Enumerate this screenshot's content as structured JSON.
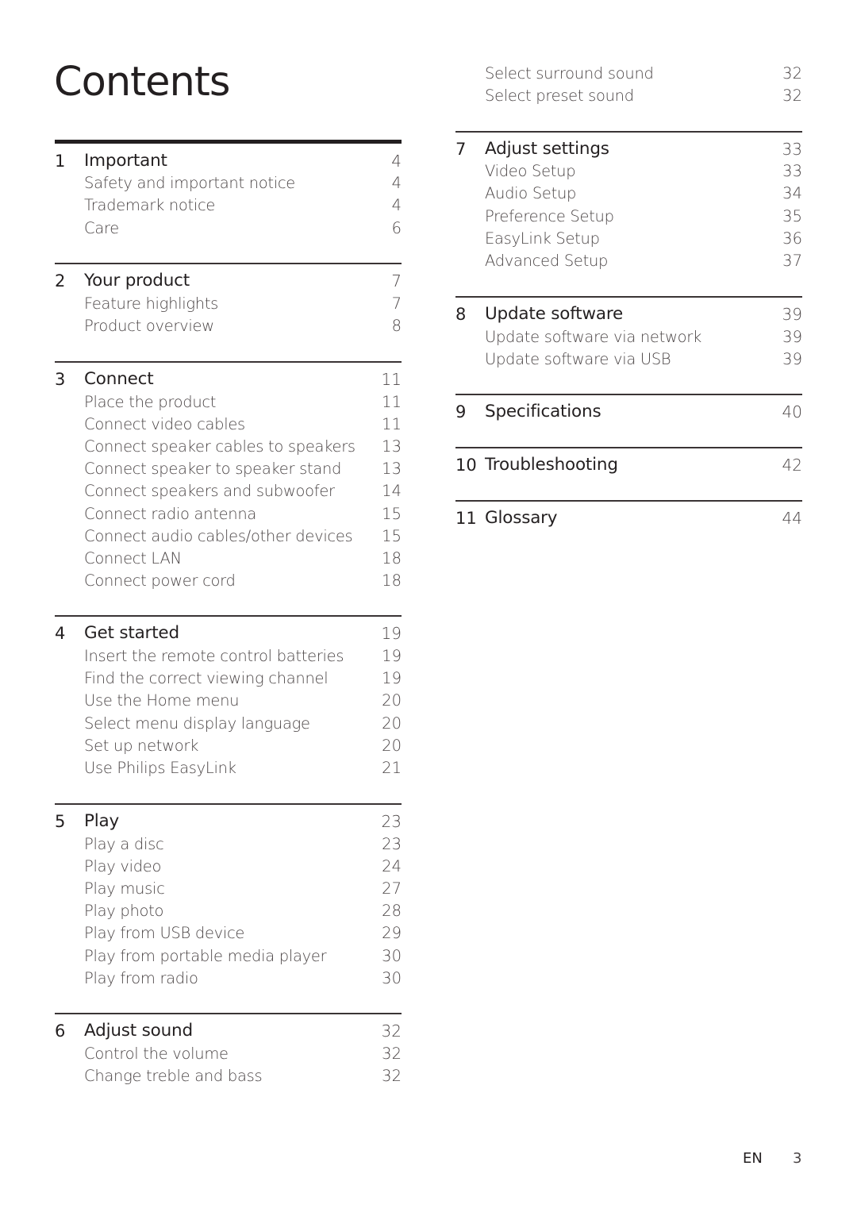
{
  "title": "Contents",
  "footer": {
    "language": "EN",
    "page_number": "3"
  },
  "sections": [
    {
      "number": "1",
      "title": "Important",
      "page": "4",
      "items": [
        {
          "label": "Safety and important notice",
          "page": "4"
        },
        {
          "label": "Trademark notice",
          "page": "4"
        },
        {
          "label": "Care",
          "page": "6"
        }
      ]
    },
    {
      "number": "2",
      "title": "Your product",
      "page": "7",
      "items": [
        {
          "label": "Feature highlights",
          "page": "7"
        },
        {
          "label": "Product overview",
          "page": "8"
        }
      ]
    },
    {
      "number": "3",
      "title": "Connect",
      "page": "11",
      "items": [
        {
          "label": "Place the product",
          "page": "11"
        },
        {
          "label": "Connect video cables",
          "page": "11"
        },
        {
          "label": "Connect speaker cables to speakers",
          "page": "13"
        },
        {
          "label": "Connect speaker to speaker stand",
          "page": "13"
        },
        {
          "label": "Connect speakers and subwoofer",
          "page": "14"
        },
        {
          "label": "Connect radio antenna",
          "page": "15"
        },
        {
          "label": "Connect audio cables/other devices",
          "page": "15"
        },
        {
          "label": "Connect LAN",
          "page": "18"
        },
        {
          "label": "Connect power cord",
          "page": "18"
        }
      ]
    },
    {
      "number": "4",
      "title": "Get started",
      "page": "19",
      "items": [
        {
          "label": "Insert the remote control batteries",
          "page": "19"
        },
        {
          "label": "Find the correct viewing channel",
          "page": "19"
        },
        {
          "label": "Use the Home menu",
          "page": "20"
        },
        {
          "label": "Select menu display language",
          "page": "20"
        },
        {
          "label": "Set up network",
          "page": "20"
        },
        {
          "label": "Use Philips EasyLink",
          "page": "21"
        }
      ]
    },
    {
      "number": "5",
      "title": "Play",
      "page": "23",
      "items": [
        {
          "label": "Play a disc",
          "page": "23"
        },
        {
          "label": "Play video",
          "page": "24"
        },
        {
          "label": "Play music",
          "page": "27"
        },
        {
          "label": "Play photo",
          "page": "28"
        },
        {
          "label": "Play from USB device",
          "page": "29"
        },
        {
          "label": "Play from portable media player",
          "page": "30"
        },
        {
          "label": "Play from radio",
          "page": "30"
        }
      ]
    },
    {
      "number": "6",
      "title": "Adjust sound",
      "page": "32",
      "items": [
        {
          "label": "Control the volume",
          "page": "32"
        },
        {
          "label": "Change treble and bass",
          "page": "32"
        },
        {
          "label": "Select surround sound",
          "page": "32"
        },
        {
          "label": "Select preset sound",
          "page": "32"
        }
      ]
    },
    {
      "number": "7",
      "title": "Adjust settings",
      "page": "33",
      "items": [
        {
          "label": "Video Setup",
          "page": "33"
        },
        {
          "label": "Audio Setup",
          "page": "34"
        },
        {
          "label": "Preference Setup",
          "page": "35"
        },
        {
          "label": "EasyLink Setup",
          "page": "36"
        },
        {
          "label": "Advanced Setup",
          "page": "37"
        }
      ]
    },
    {
      "number": "8",
      "title": "Update software",
      "page": "39",
      "items": [
        {
          "label": "Update software via network",
          "page": "39"
        },
        {
          "label": "Update software via USB",
          "page": "39"
        }
      ]
    },
    {
      "number": "9",
      "title": "Specifications",
      "page": "40",
      "items": []
    },
    {
      "number": "10",
      "title": "Troubleshooting",
      "page": "42",
      "items": []
    },
    {
      "number": "11",
      "title": "Glossary",
      "page": "44",
      "items": []
    }
  ]
}
